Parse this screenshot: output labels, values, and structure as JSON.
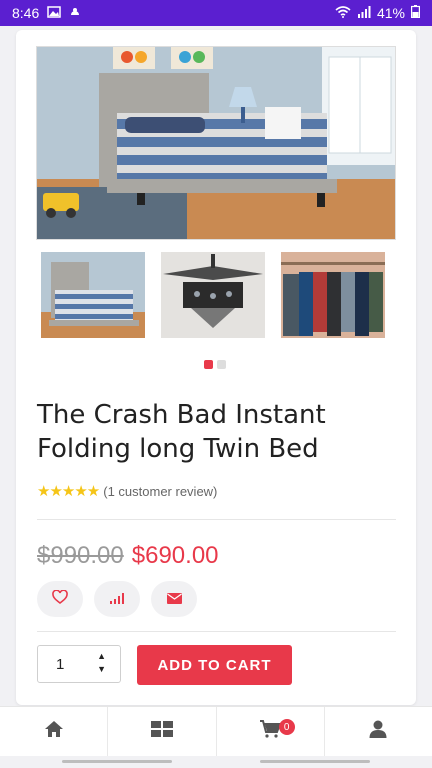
{
  "status": {
    "time": "8:46",
    "battery": "41%",
    "icons": [
      "image-icon",
      "android-icon",
      "wifi-icon",
      "signal-icon",
      "battery-icon"
    ]
  },
  "product": {
    "title": "The Crash Bad Instant Folding long Twin Bed",
    "rating_stars": 5,
    "review_text": "(1 customer review)",
    "old_price": "$990.00",
    "new_price": "$690.00",
    "thumbnails": [
      "bed-thumbnail",
      "chandelier-thumbnail",
      "clothes-rack-thumbnail"
    ],
    "gallery_index": 1,
    "gallery_count": 2
  },
  "actions": {
    "icons": [
      "heart-icon",
      "signal-bars-icon",
      "mail-icon"
    ]
  },
  "cart": {
    "quantity": "1",
    "add_label": "ADD TO CART"
  },
  "nav": {
    "items": [
      "home-icon",
      "grid-icon",
      "cart-icon",
      "user-icon"
    ],
    "cart_badge": "0"
  },
  "colors": {
    "status_bar": "#5b1fd0",
    "accent": "#e8394a",
    "star": "#f5c518"
  }
}
